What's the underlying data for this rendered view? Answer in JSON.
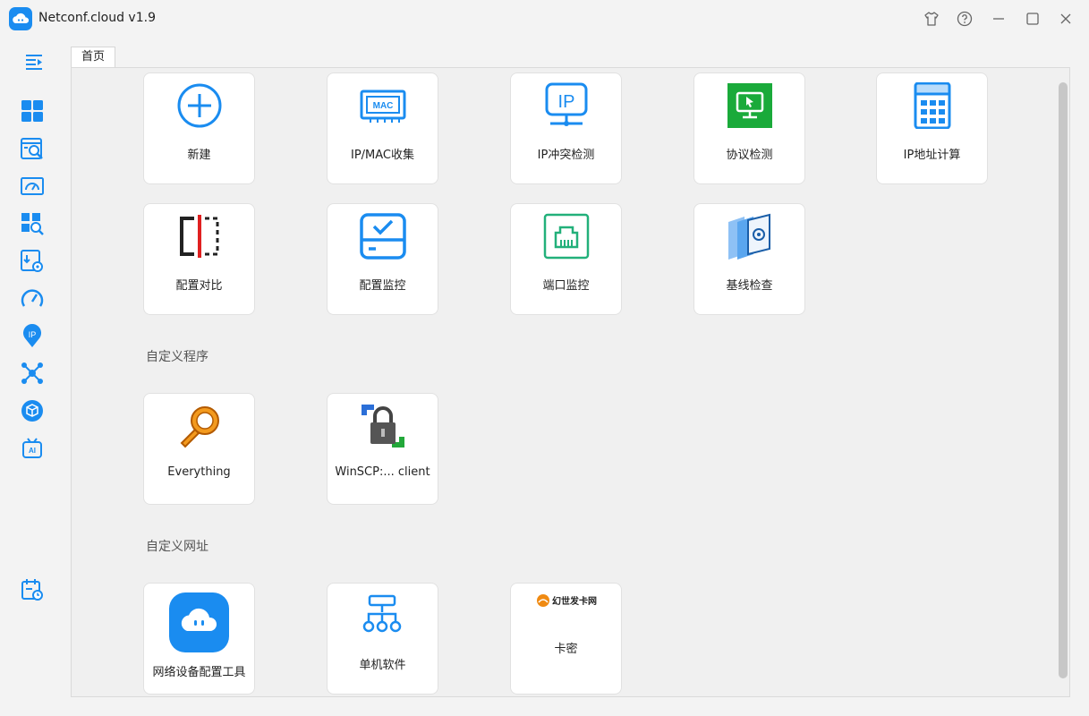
{
  "window": {
    "title": "Netconf.cloud v1.9"
  },
  "titlebar_icons": [
    "shirt-icon",
    "help-icon",
    "minimize-icon",
    "maximize-icon",
    "close-icon"
  ],
  "sidebar": {
    "toggle_icon": "menu-collapse-icon",
    "items": [
      "dashboard-icon",
      "config-search-icon",
      "monitor-icon",
      "search-grid-icon",
      "download-settings-icon",
      "gauge-icon",
      "ip-location-icon",
      "network-topology-icon",
      "cube-icon",
      "ai-tv-icon"
    ],
    "bottom_item": "calendar-schedule-icon"
  },
  "tabs": [
    {
      "label": "首页"
    }
  ],
  "tools": [
    {
      "label": "新建",
      "icon": "plus-circle-icon"
    },
    {
      "label": "IP/MAC收集",
      "icon": "mac-chip-icon"
    },
    {
      "label": "IP冲突检测",
      "icon": "ip-monitor-icon"
    },
    {
      "label": "协议检测",
      "icon": "protocol-screen-icon"
    },
    {
      "label": "IP地址计算",
      "icon": "calculator-icon"
    },
    {
      "label": "配置对比",
      "icon": "compare-icon"
    },
    {
      "label": "配置监控",
      "icon": "config-monitor-icon"
    },
    {
      "label": "端口监控",
      "icon": "port-icon"
    },
    {
      "label": "基线检查",
      "icon": "baseline-icon"
    }
  ],
  "custom_programs": {
    "title": "自定义程序",
    "items": [
      {
        "label": "Everything",
        "icon": "everything-icon"
      },
      {
        "label": "WinSCP:... client",
        "icon": "winscp-icon"
      }
    ]
  },
  "custom_urls": {
    "title": "自定义网址",
    "items": [
      {
        "label": "网络设备配置工具",
        "icon": "cloud-logo-icon"
      },
      {
        "label": "单机软件",
        "icon": "sitemap-icon"
      },
      {
        "label": "卡密",
        "icon": "shop-logo-icon",
        "logo_text": "幻世发卡网"
      }
    ]
  },
  "colors": {
    "accent": "#1a8cf0",
    "background": "#f0f0f0",
    "card": "#ffffff"
  }
}
